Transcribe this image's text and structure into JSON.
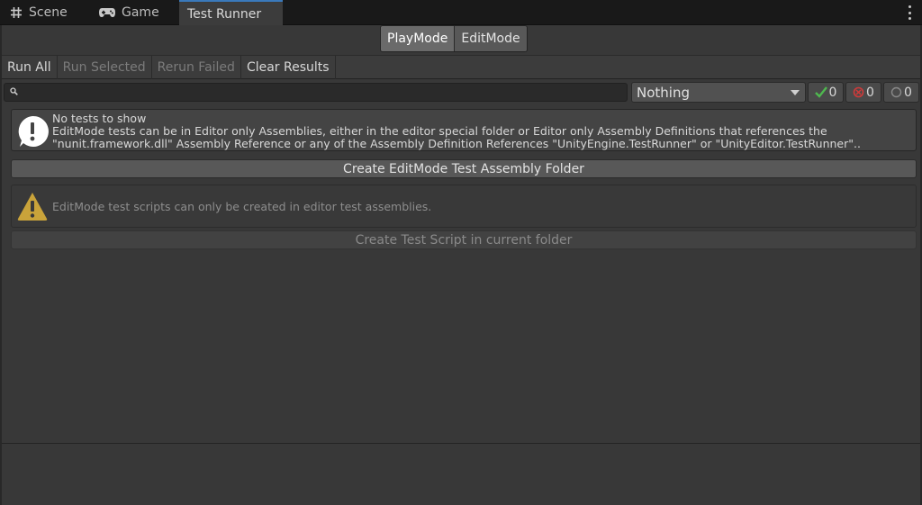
{
  "tabs": [
    {
      "label": "Scene",
      "icon": "grid-icon"
    },
    {
      "label": "Game",
      "icon": "gamepad-icon"
    },
    {
      "label": "Test Runner",
      "icon": ""
    }
  ],
  "mode_toggle": {
    "playmode": "PlayMode",
    "editmode": "EditMode",
    "selected": "PlayMode"
  },
  "toolbar": {
    "run_all": "Run All",
    "run_selected": "Run Selected",
    "rerun_failed": "Rerun Failed",
    "clear_results": "Clear Results"
  },
  "search": {
    "value": "",
    "placeholder": ""
  },
  "filter_dropdown": {
    "selected": "Nothing"
  },
  "counters": {
    "passed": "0",
    "failed": "0",
    "skipped": "0"
  },
  "info": {
    "line1": "No tests to show",
    "line2": "EditMode tests can be in Editor only Assemblies, either in the editor special folder or Editor only Assembly Definitions that references the",
    "line3": "\"nunit.framework.dll\" Assembly Reference or any of the Assembly Definition References \"UnityEngine.TestRunner\" or \"UnityEditor.TestRunner\".."
  },
  "create_folder_button": "Create EditMode Test Assembly Folder",
  "warning": {
    "text": "EditMode test scripts can only be created in editor test assemblies."
  },
  "create_script_button": "Create Test Script in current folder",
  "colors": {
    "pass": "#4fb84f",
    "fail": "#d03a3a",
    "skip": "#8a8a8a",
    "tab_accent": "#3a79bb",
    "warning": "#c9a33a"
  }
}
